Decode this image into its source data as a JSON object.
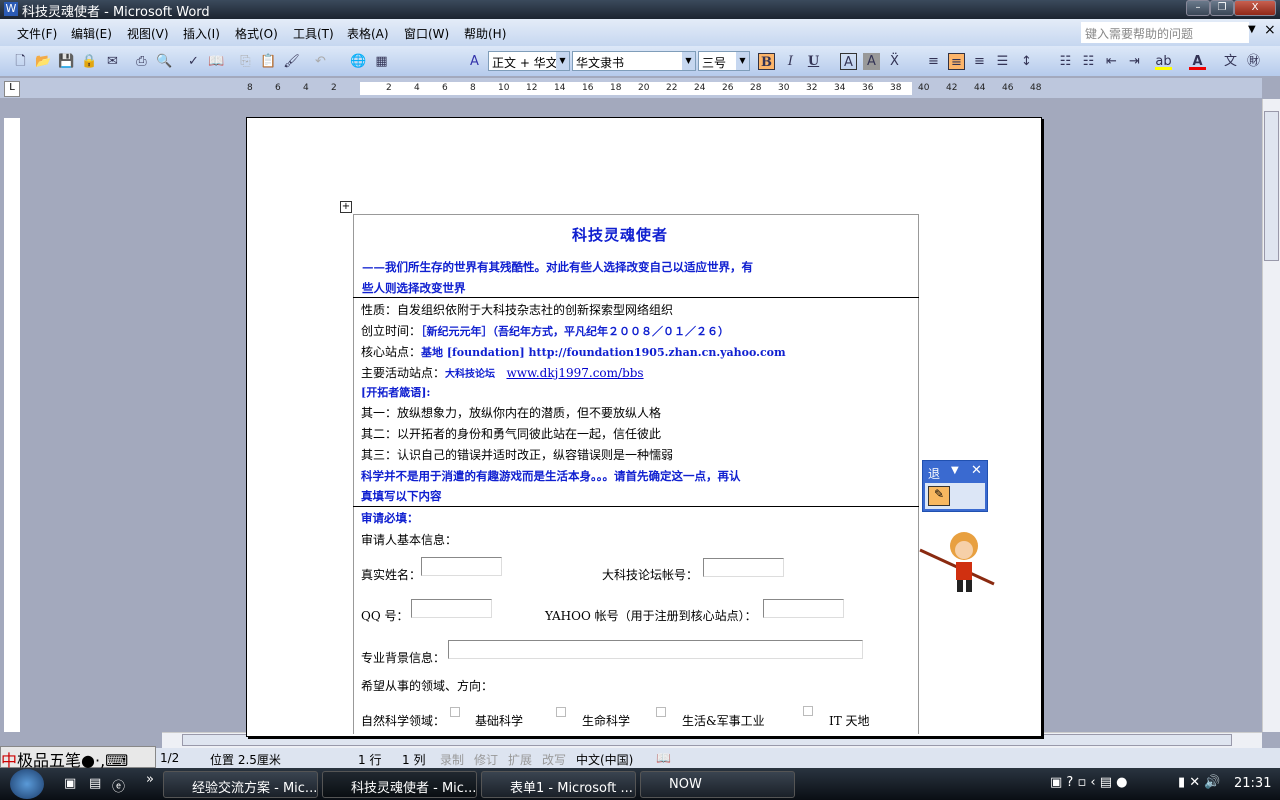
{
  "window": {
    "title": "科技灵魂使者 - Microsoft Word",
    "min": "–",
    "restore": "❐",
    "close": "X"
  },
  "menu": [
    "文件(F)",
    "编辑(E)",
    "视图(V)",
    "插入(I)",
    "格式(O)",
    "工具(T)",
    "表格(A)",
    "窗口(W)",
    "帮助(H)"
  ],
  "help": {
    "placeholder": "键入需要帮助的问题",
    "close": "×"
  },
  "toolbar": {
    "style": "正文 + 华文",
    "font": "华文隶书",
    "size": "三号",
    "bold": "B",
    "italic": "I",
    "underline": "U"
  },
  "ruler": {
    "left": [
      "8",
      "6",
      "4",
      "2"
    ],
    "right": [
      "2",
      "4",
      "6",
      "8",
      "10",
      "12",
      "14",
      "16",
      "18",
      "20",
      "22",
      "24",
      "26",
      "28",
      "30",
      "32",
      "34",
      "36",
      "38",
      "40",
      "42",
      "44",
      "46",
      "48"
    ]
  },
  "doc": {
    "title": "科技灵魂使者",
    "subtitle1": "——我们所生存的世界有其残酷性。对此有些人选择改变自己以适应世界，有",
    "subtitle2": "些人则选择改变世界",
    "nature": "性质：自发组织依附于大科技杂志社的创新探索型网络组织",
    "founded_label": "创立时间：",
    "founded_value": "［新纪元元年］（吾纪年方式，平凡纪年２００８／０１／２６）",
    "core_label": "核心站点：",
    "core_value": "基地 [foundation] http://foundation1905.zhan.cn.yahoo.com",
    "main_label": "主要活动站点：",
    "main_forum": "大科技论坛",
    "main_link": "www.dkj1997.com/bbs",
    "motto_title": "[开拓者箴语]:",
    "motto1": "其一：放纵想象力，放纵你内在的潜质，但不要放纵人格",
    "motto2": "其二：以开拓者的身份和勇气同彼此站在一起，信任彼此",
    "motto3": "其三：认识自己的错误并适时改正，纵容错误则是一种懦弱",
    "science1": "科学并不是用于消遣的有趣游戏而是生活本身。。。请首先确定这一点，再认",
    "science2": "真填写以下内容",
    "required": "审请必填：",
    "basic": "审请人基本信息：",
    "realname": "真实姓名：",
    "forum_acct": "大科技论坛帐号：",
    "qq": "QQ 号：",
    "yahoo": "YAHOO 帐号（用于注册到核心站点）：",
    "background": "专业背景信息：",
    "wish": "希望从事的领域、方向：",
    "natural": "自然科学领域：",
    "opts": [
      "基础科学",
      "生命科学",
      "生活&军事工业",
      "IT 天地"
    ]
  },
  "floatbar": {
    "label": "退"
  },
  "status": {
    "ime": "极品五笔",
    "page": "1/2",
    "pos": "位置 2.5厘米",
    "line": "1 行",
    "col": "1 列",
    "rec": "录制",
    "trk": "修订",
    "ext": "扩展",
    "ovr": "改写",
    "lang": "中文(中国)"
  },
  "taskbar": {
    "tasks": [
      "经验交流方案 - Mic...",
      "科技灵魂使者 - Mic...",
      "表单1 - Microsoft ...",
      "NOW"
    ],
    "time": "21:31"
  }
}
